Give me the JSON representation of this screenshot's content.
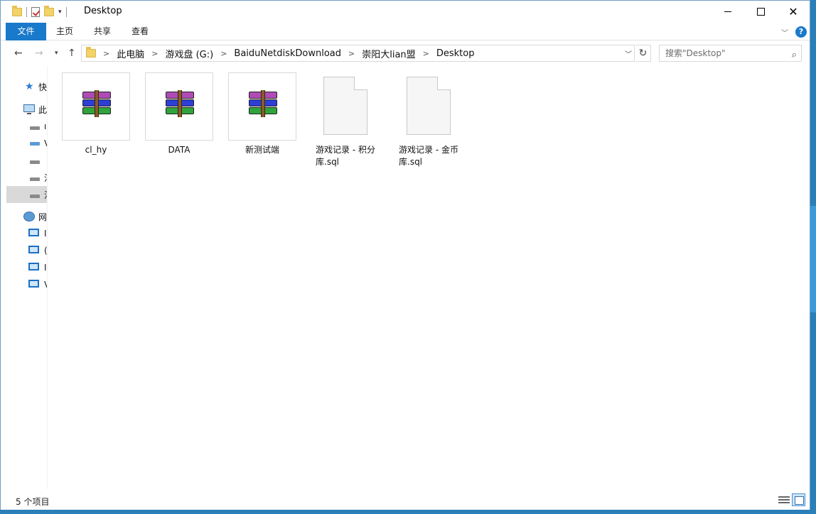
{
  "window": {
    "title": "Desktop"
  },
  "ribbon": {
    "tabs": [
      "文件",
      "主页",
      "共享",
      "查看"
    ],
    "help": "?"
  },
  "address": {
    "breadcrumbs": [
      "此电脑",
      "游戏盘 (G:)",
      "BaiduNetdiskDownload",
      "崇阳大lian盟",
      "Desktop"
    ],
    "separator": ">"
  },
  "search": {
    "placeholder": "搜索\"Desktop\""
  },
  "navpane": {
    "items": [
      {
        "label": "快",
        "icon": "star-icon"
      },
      {
        "label": "此",
        "icon": "computer-icon"
      },
      {
        "label": "\u0000",
        "icon": "drive-icon"
      },
      {
        "label": "V",
        "icon": "network-drive-icon"
      },
      {
        "label": "卜",
        "icon": "drive-icon"
      },
      {
        "label": "汕",
        "icon": "drive-icon"
      },
      {
        "label": "汕",
        "icon": "drive-icon",
        "selected": true
      },
      {
        "label": "网",
        "icon": "network-icon"
      },
      {
        "label": "I",
        "icon": "network-computer-icon"
      },
      {
        "label": "(",
        "icon": "network-computer-icon"
      },
      {
        "label": "I",
        "icon": "network-computer-icon"
      },
      {
        "label": "V",
        "icon": "network-computer-icon"
      }
    ]
  },
  "files": [
    {
      "name": "cl_hy",
      "type": "archive",
      "icon": "winrar-archive-icon"
    },
    {
      "name": "DATA",
      "type": "archive",
      "icon": "winrar-archive-icon"
    },
    {
      "name": "新测试端",
      "type": "archive",
      "icon": "winrar-archive-icon"
    },
    {
      "name": "游戏记录 - 积分库.sql",
      "type": "document",
      "icon": "blank-document-icon"
    },
    {
      "name": "游戏记录 - 金币库.sql",
      "type": "document",
      "icon": "blank-document-icon"
    }
  ],
  "status": {
    "item_count": "5 个项目"
  },
  "colors": {
    "accent": "#1979ca",
    "selection": "#d9d9d9",
    "desktop": "#2a7fb8"
  }
}
